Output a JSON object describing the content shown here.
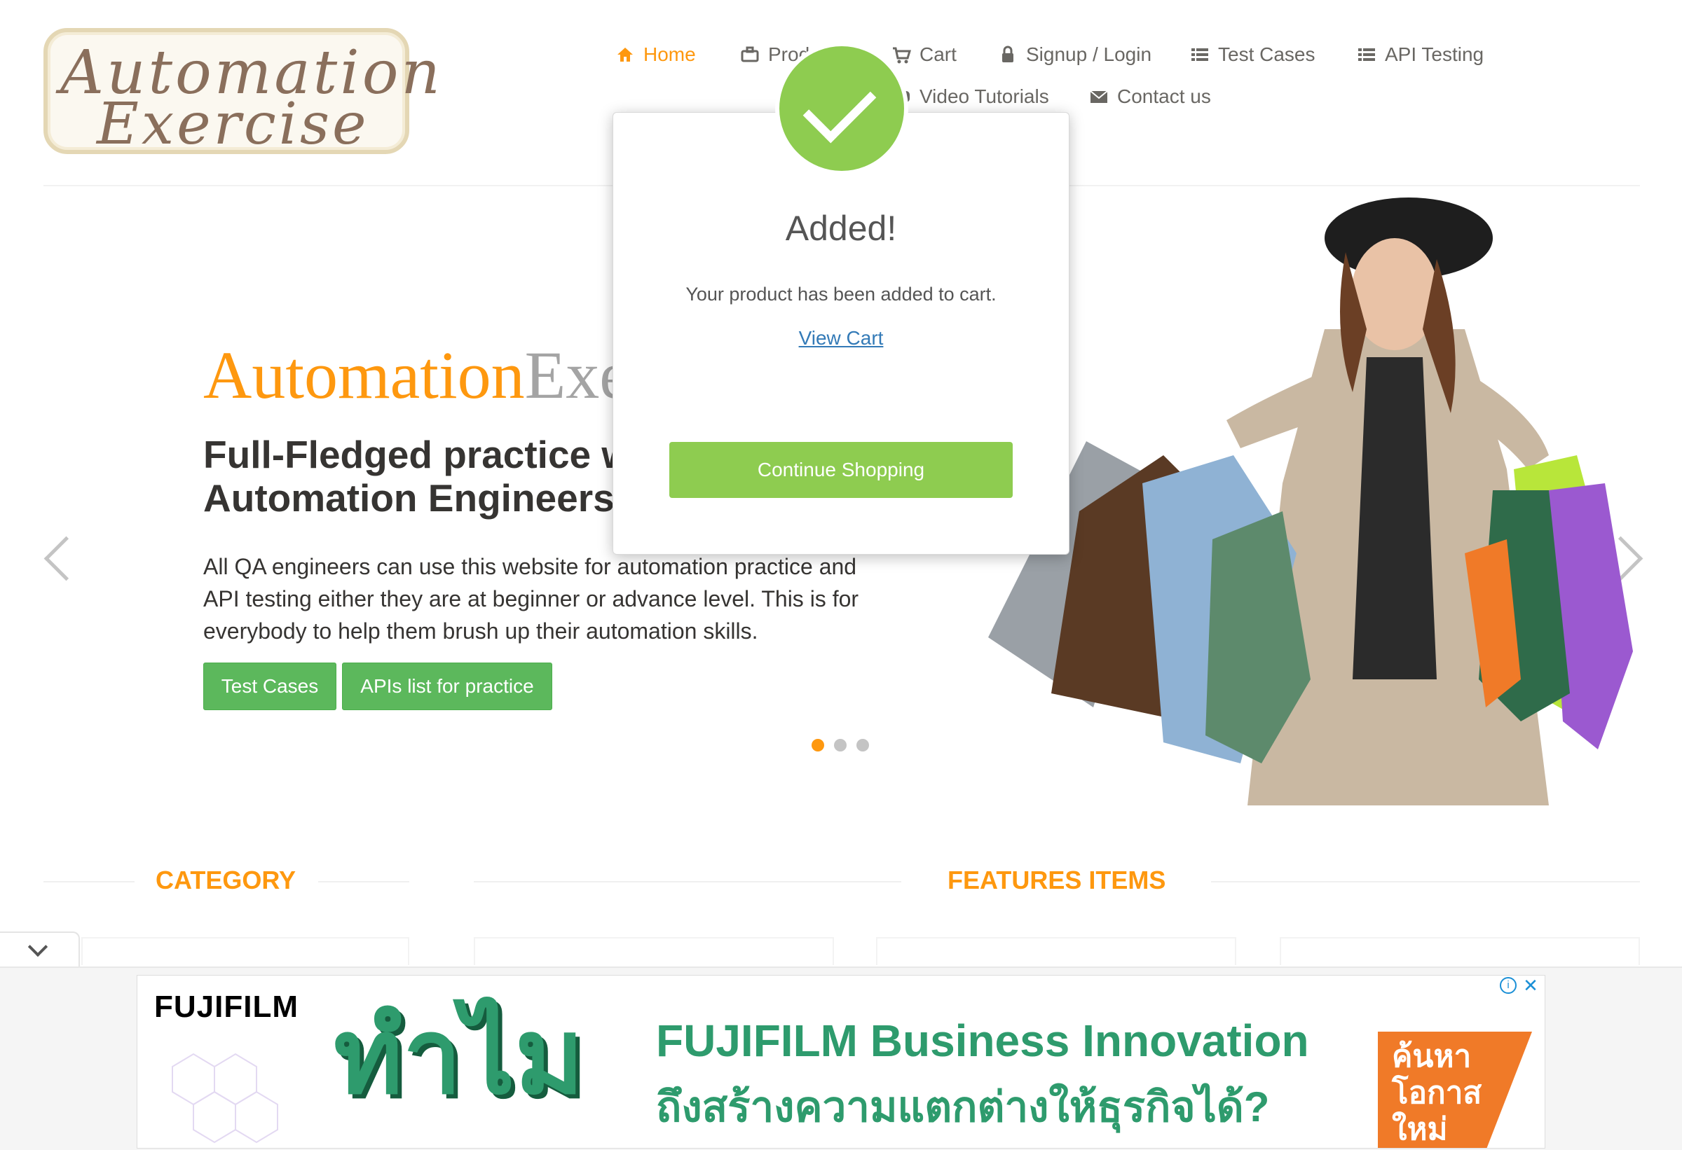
{
  "logo": {
    "line1": "Automation",
    "line2": "Exercise"
  },
  "nav": {
    "home": "Home",
    "products": "Products",
    "cart": "Cart",
    "signup_login": "Signup / Login",
    "test_cases": "Test Cases",
    "api_testing": "API Testing",
    "video_tutorials": "Video Tutorials",
    "contact_us": "Contact us"
  },
  "slider": {
    "brand_a": "Automation",
    "brand_b": "Exercise",
    "heading_line1": "Full-Fledged practice website for",
    "heading_line2": "Automation Engineers",
    "description": "All QA engineers can use this website for automation practice and API testing either they are at beginner or advance level. This is for everybody to help them brush up their automation skills.",
    "btn_test_cases": "Test Cases",
    "btn_apis": "APIs list for practice",
    "active_slide": 1,
    "slide_count": 3
  },
  "sections": {
    "category": "CATEGORY",
    "features": "FEATURES ITEMS"
  },
  "modal": {
    "title": "Added!",
    "message": "Your product has been added to cart.",
    "view_cart": "View Cart",
    "continue_button": "Continue Shopping"
  },
  "ad": {
    "brand": "FUJIFILM",
    "big_thai": "ทำไม",
    "headline": "FUJIFILM Business Innovation",
    "sub": "ถึงสร้างความแตกต่างให้ธุรกิจได้?",
    "cta": "ค้นหา โอกาส ใหม่",
    "info": "i",
    "close": "✕"
  },
  "colors": {
    "accent_orange": "#fe980f",
    "button_green": "#5cb85c",
    "modal_green": "#8ecc50",
    "link_blue": "#337ab7"
  }
}
